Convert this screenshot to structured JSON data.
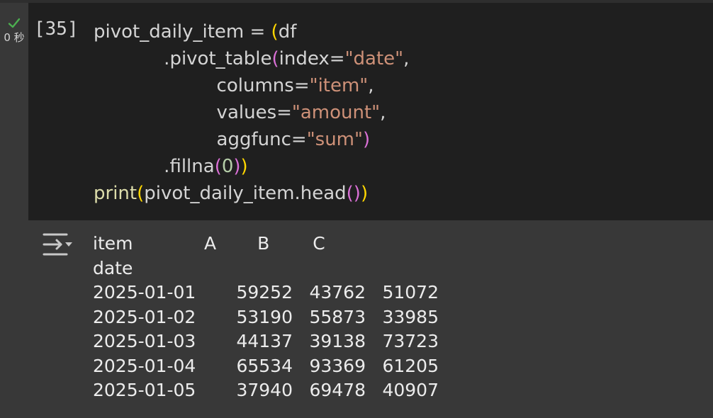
{
  "cell": {
    "status_icon": "check-icon",
    "exec_time": "0 秒",
    "exec_count": "[35]",
    "code_lines": [
      [
        {
          "t": "pivot_daily_item = ",
          "c": ""
        },
        {
          "t": "(",
          "c": "p1"
        },
        {
          "t": "df",
          "c": ""
        }
      ],
      [
        {
          "t": "            .pivot_table",
          "c": ""
        },
        {
          "t": "(",
          "c": "p2"
        },
        {
          "t": "index=",
          "c": ""
        },
        {
          "t": "\"date\"",
          "c": "str"
        },
        {
          "t": ",",
          "c": ""
        }
      ],
      [
        {
          "t": "                     columns=",
          "c": ""
        },
        {
          "t": "\"item\"",
          "c": "str"
        },
        {
          "t": ",",
          "c": ""
        }
      ],
      [
        {
          "t": "                     values=",
          "c": ""
        },
        {
          "t": "\"amount\"",
          "c": "str"
        },
        {
          "t": ",",
          "c": ""
        }
      ],
      [
        {
          "t": "                     aggfunc=",
          "c": ""
        },
        {
          "t": "\"sum\"",
          "c": "str"
        },
        {
          "t": ")",
          "c": "p2"
        }
      ],
      [
        {
          "t": "            .fillna",
          "c": ""
        },
        {
          "t": "(",
          "c": "p2"
        },
        {
          "t": "0",
          "c": "num"
        },
        {
          "t": ")",
          "c": "p2"
        },
        {
          "t": ")",
          "c": "p1"
        }
      ],
      [
        {
          "t": "print",
          "c": "fn"
        },
        {
          "t": "(",
          "c": "p1"
        },
        {
          "t": "pivot_daily_item.head",
          "c": ""
        },
        {
          "t": "()",
          "c": "p2"
        },
        {
          "t": ")",
          "c": "p1"
        }
      ]
    ]
  },
  "output": {
    "toggle_icon": "output-collapse-icon",
    "columns_name": "item",
    "index_name": "date",
    "columns": [
      "A",
      "B",
      "C"
    ],
    "rows": [
      {
        "date": "2025-01-01",
        "A": "59252",
        "B": "43762",
        "C": "51072"
      },
      {
        "date": "2025-01-02",
        "A": "53190",
        "B": "55873",
        "C": "33985"
      },
      {
        "date": "2025-01-03",
        "A": "44137",
        "B": "39138",
        "C": "73723"
      },
      {
        "date": "2025-01-04",
        "A": "65534",
        "B": "93369",
        "C": "61205"
      },
      {
        "date": "2025-01-05",
        "A": "37940",
        "B": "69478",
        "C": "40907"
      }
    ]
  },
  "colors": {
    "background": "#383838",
    "cell_background": "#1f1f1f",
    "success": "#4caf50",
    "string": "#ce9178",
    "function": "#dcdcaa",
    "number": "#b5cea8",
    "bracket_level1": "#ffd700",
    "bracket_level2": "#da70d6"
  }
}
